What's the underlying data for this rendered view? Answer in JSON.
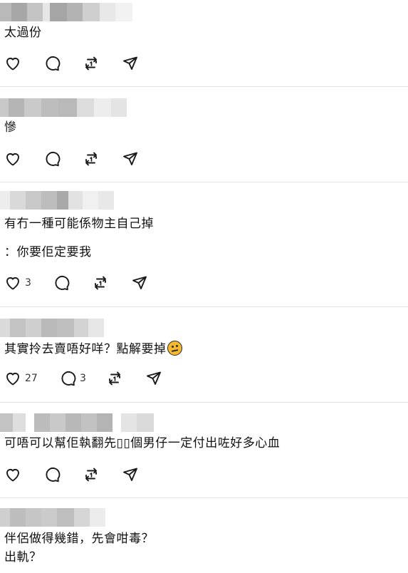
{
  "posts": [
    {
      "lines": [
        "太過份"
      ],
      "likes": "",
      "replies": ""
    },
    {
      "lines": [
        "慘"
      ],
      "likes": "",
      "replies": ""
    },
    {
      "lines": [
        "有冇一種可能係物主自己掉",
        "：你要佢定要我"
      ],
      "likes": "3",
      "replies": ""
    },
    {
      "lines": [
        "其實拎去賣唔好咩？點解要掉"
      ],
      "likes": "27",
      "replies": "3",
      "emoji": "thinking-face"
    },
    {
      "lines": [
        "可唔可以幫佢執翻先▯▯個男仔一定付出咗好多心血"
      ],
      "likes": "",
      "replies": ""
    },
    {
      "lines": [
        "伴侶做得幾錯，先會咁毒？",
        "出軌？"
      ],
      "likes": "",
      "replies": ""
    }
  ],
  "icons": {
    "like": "heart-icon",
    "reply": "comment-bubble-icon",
    "repost": "repost-icon",
    "share": "send-icon"
  },
  "colors": {
    "text": "#111111",
    "icon": "#1a1a1a",
    "divider": "#e3e3e3"
  }
}
